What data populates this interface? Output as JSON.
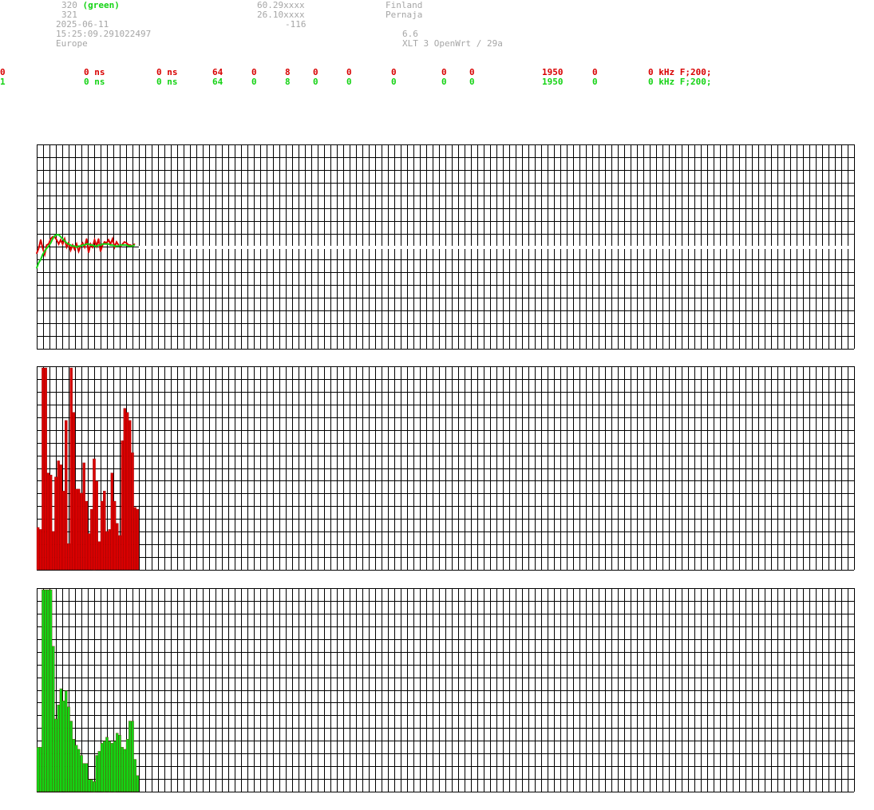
{
  "header": {
    "left": {
      "line1_num": "320",
      "line1_tag": "(green)",
      "line2": "321",
      "date": "2025-06-11",
      "time": "15:25:09.291022497",
      "region": "Europe"
    },
    "mid": {
      "lat": "60.29xxxx",
      "lon": "26.10xxxx",
      "value": "-116"
    },
    "right": {
      "country": "Finland",
      "city": "Pernaja",
      "version": "6.6",
      "firmware": "XLT 3 OpenWrt / 29a"
    }
  },
  "rows": [
    {
      "cells": [
        "0",
        "0 ns",
        "0 ns",
        "64",
        "0",
        "8",
        "0",
        "0",
        "0",
        "0",
        "0",
        "1950",
        "0",
        "0 kHz F;200;"
      ]
    },
    {
      "cells": [
        "1",
        "0 ns",
        "0 ns",
        "64",
        "0",
        "8",
        "0",
        "0",
        "0",
        "0",
        "0",
        "1950",
        "0",
        "0 kHz F;200;"
      ]
    }
  ],
  "colors": {
    "red": "#d80000",
    "green": "#14d314",
    "grid": "#000000",
    "text_gray": "#a6a6a6"
  },
  "chart_data": [
    {
      "type": "line",
      "series": [
        {
          "color": "#d80000",
          "values": [
            -5,
            0,
            8,
            0,
            -6,
            3,
            4,
            9,
            11,
            11,
            8,
            4,
            8,
            4,
            9,
            1,
            5,
            -2,
            3,
            -1,
            4,
            -3,
            2,
            5,
            1,
            9,
            -4,
            4,
            1,
            8,
            2,
            9,
            -3,
            3,
            6,
            5,
            8,
            4,
            9,
            1,
            6,
            3,
            2,
            4,
            6,
            5,
            3,
            3,
            2,
            4
          ]
        },
        {
          "color": "#14d314",
          "values": [
            -19,
            -14,
            -11,
            -6,
            -3,
            0,
            2,
            5,
            9,
            12,
            13,
            13,
            11,
            9,
            7,
            5,
            4,
            3,
            2,
            2,
            1,
            2,
            2,
            3,
            3,
            4,
            4,
            3,
            3,
            2,
            2,
            3,
            3,
            4,
            4,
            4,
            4,
            3,
            3,
            2,
            2,
            2,
            3,
            3,
            3,
            3,
            2,
            2,
            2,
            3
          ]
        }
      ]
    },
    {
      "type": "bar",
      "color": "#d80000",
      "values": [
        21,
        20,
        100,
        100,
        48,
        47,
        19,
        46,
        54,
        52,
        39,
        74,
        13,
        100,
        78,
        40,
        40,
        38,
        53,
        34,
        18,
        30,
        55,
        44,
        14,
        34,
        39,
        19,
        20,
        48,
        34,
        23,
        17,
        64,
        80,
        78,
        74,
        58,
        31,
        30
      ]
    },
    {
      "type": "bar",
      "color": "#14d314",
      "values": [
        22,
        22,
        100,
        100,
        100,
        100,
        72,
        36,
        43,
        51,
        45,
        50,
        42,
        35,
        26,
        23,
        21,
        18,
        14,
        14,
        6,
        6,
        5,
        18,
        20,
        24,
        25,
        27,
        25,
        24,
        25,
        29,
        28,
        22,
        21,
        26,
        35,
        35,
        16,
        8
      ]
    }
  ]
}
